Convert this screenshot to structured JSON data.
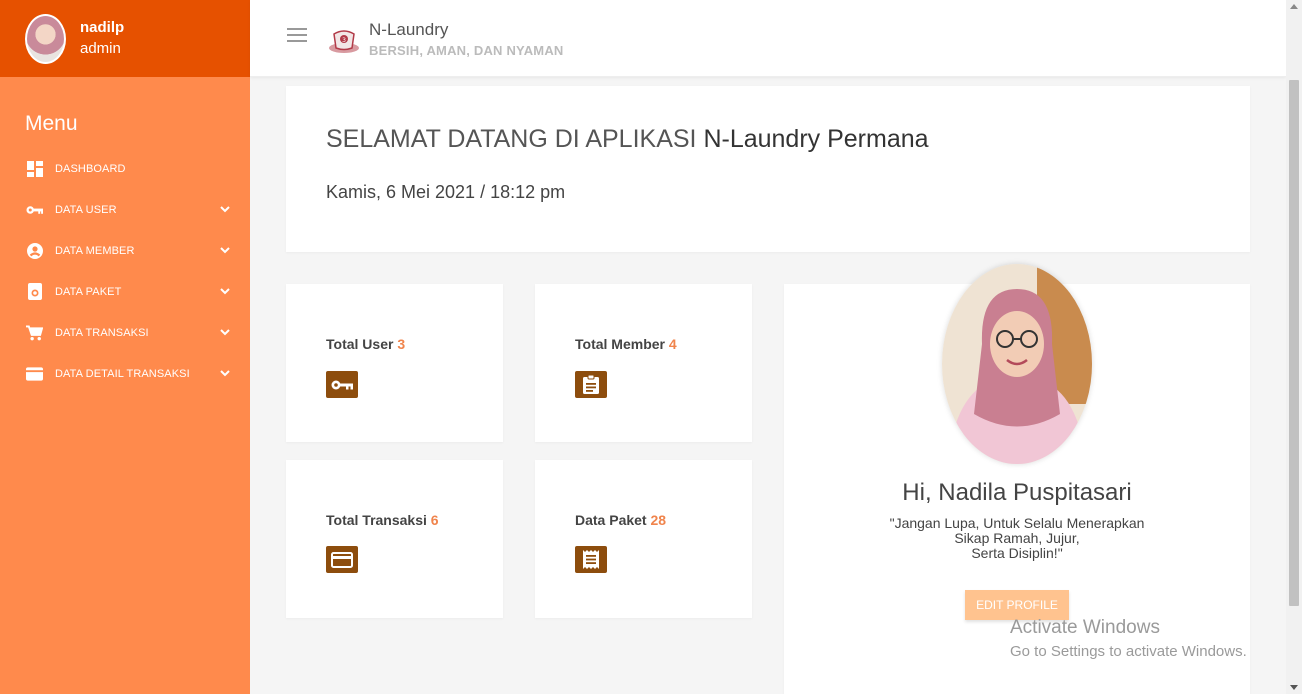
{
  "user": {
    "name": "nadilp",
    "role": "admin"
  },
  "sidebar": {
    "menu_title": "Menu",
    "items": [
      {
        "label": "DASHBOARD",
        "icon": "dashboard-icon",
        "has_submenu": false
      },
      {
        "label": "DATA USER",
        "icon": "key-icon",
        "has_submenu": true
      },
      {
        "label": "DATA MEMBER",
        "icon": "account-circle-icon",
        "has_submenu": true
      },
      {
        "label": "DATA PAKET",
        "icon": "package-icon",
        "has_submenu": true
      },
      {
        "label": "DATA TRANSAKSI",
        "icon": "cart-icon",
        "has_submenu": true
      },
      {
        "label": "DATA DETAIL TRANSAKSI",
        "icon": "credit-card-icon",
        "has_submenu": true
      }
    ]
  },
  "header": {
    "app_name": "N-Laundry",
    "tagline": "BERSIH, AMAN, DAN NYAMAN"
  },
  "welcome": {
    "prefix": "SELAMAT DATANG DI APLIKASI",
    "app_full": "N-Laundry Permana",
    "datetime": "Kamis, 6 Mei 2021 / 18:12 pm"
  },
  "stats": [
    {
      "label": "Total User",
      "count": "3",
      "icon": "key-icon"
    },
    {
      "label": "Total Member",
      "count": "4",
      "icon": "clipboard-icon"
    },
    {
      "label": "Total Transaksi",
      "count": "6",
      "icon": "credit-card-icon"
    },
    {
      "label": "Data Paket",
      "count": "28",
      "icon": "receipt-icon"
    }
  ],
  "profile": {
    "greeting": "Hi, Nadila Puspitasari",
    "quote_line1": "\"Jangan Lupa, Untuk Selalu Menerapkan",
    "quote_line2": "Sikap Ramah, Jujur,",
    "quote_line3": "Serta Disiplin!\"",
    "edit_label": "EDIT PROFILE"
  },
  "watermark": {
    "line1": "Activate Windows",
    "line2": "Go to Settings to activate Windows."
  },
  "colors": {
    "sidebar_bg": "#ff8a4c",
    "profile_bar_bg": "#e65100",
    "accent": "#f0844c",
    "icon_bg": "#8d4d0d",
    "button_bg": "#ffc38f"
  }
}
